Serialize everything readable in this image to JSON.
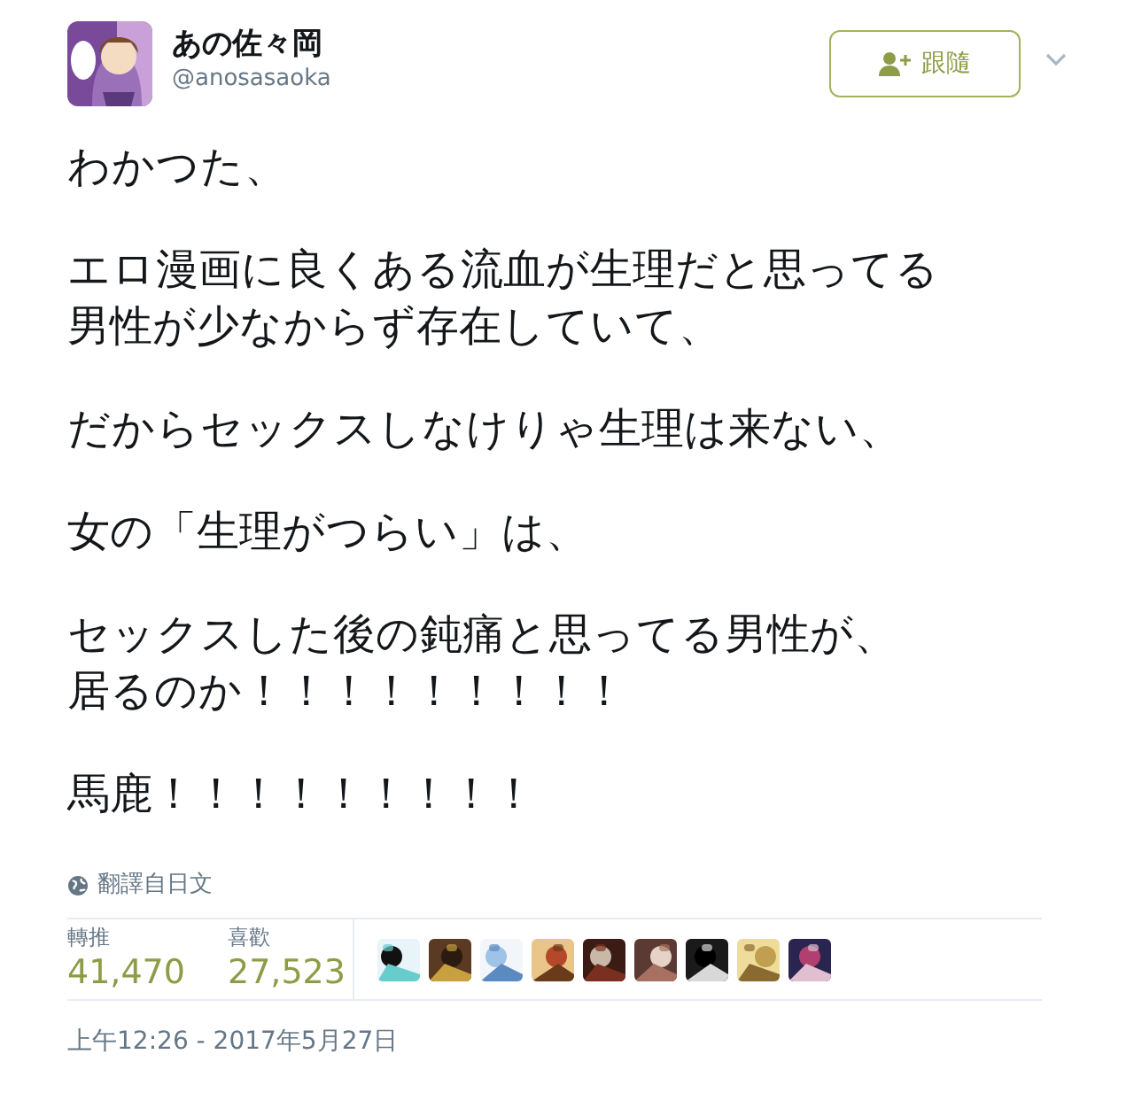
{
  "author": {
    "name": "あの佐々岡",
    "handle": "@anosasaoka"
  },
  "follow_button": {
    "label": "跟隨"
  },
  "tweet_paragraphs": [
    {
      "lines": [
        "わかつた、"
      ]
    },
    {
      "lines": [
        "エロ漫画に良くある流血が生理だと思ってる",
        "男性が少なからず存在していて、"
      ]
    },
    {
      "lines": [
        "だからセックスしなけりゃ生理は来ない、"
      ]
    },
    {
      "lines": [
        "女の「生理がつらい」は、"
      ]
    },
    {
      "lines": [
        "セックスした後の鈍痛と思ってる男性が、",
        "居るのか！！！！！！！！！"
      ]
    },
    {
      "lines": [
        "馬鹿！！！！！！！！！"
      ]
    }
  ],
  "translation_note": "翻譯自日文",
  "stats": [
    {
      "label": "轉推",
      "value": "41,470"
    },
    {
      "label": "喜歡",
      "value": "27,523"
    }
  ],
  "timestamp": "上午12:26 - 2017年5月27日"
}
